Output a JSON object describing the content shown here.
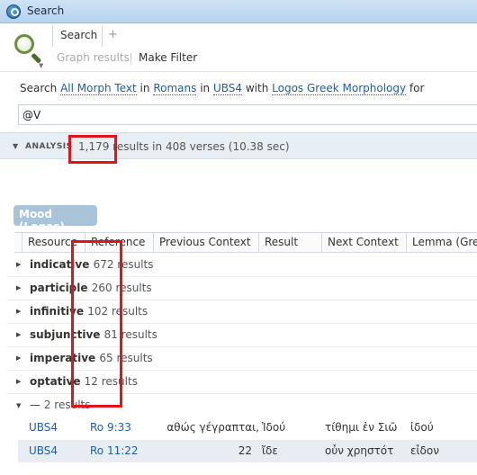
{
  "window": {
    "title": "Search"
  },
  "toolbar": {
    "tab_search": "Search",
    "tab_add": "+",
    "graph_results": "Graph results",
    "make_filter": "Make Filter"
  },
  "query": {
    "prefix": "Search",
    "scope": "All Morph Text",
    "in1": "in",
    "book": "Romans",
    "in2": "in",
    "edition": "UBS4",
    "with": "with",
    "morphology": "Logos Greek Morphology",
    "for": "for",
    "input_value": "@V"
  },
  "analysis": {
    "label": "ANALYSIS",
    "summary": "1,179 results in 408 verses (10.38 sec)"
  },
  "mood_chip": "Mood (Logos)",
  "columns": [
    "Resource",
    "Reference",
    "Previous Context",
    "Result",
    "Next Context",
    "Lemma (Gre"
  ],
  "groups": [
    {
      "name": "indicative",
      "count": "672 results"
    },
    {
      "name": "participle",
      "count": "260 results"
    },
    {
      "name": "infinitive",
      "count": "102 results"
    },
    {
      "name": "subjunctive",
      "count": "81 results"
    },
    {
      "name": "imperative",
      "count": "65 results"
    },
    {
      "name": "optative",
      "count": "12 results"
    },
    {
      "name": "—",
      "count": "2 results"
    }
  ],
  "rows": [
    {
      "resource": "UBS4",
      "reference": "Ro 9:33",
      "previous": "αθώς γέγραπται,",
      "result": "Ἰδού",
      "next": "τίθημι ἐν Σιῶ",
      "lemma": "ἰδού"
    },
    {
      "resource": "UBS4",
      "reference": "Ro 11:22",
      "previous": "22",
      "result": "ἴδε",
      "next": "οὖν χρηστότ",
      "lemma": "εἶδον"
    }
  ],
  "colors": {
    "link": "#1e5ea6",
    "annotation": "#e0141b",
    "chip": "#a9c3d8"
  }
}
